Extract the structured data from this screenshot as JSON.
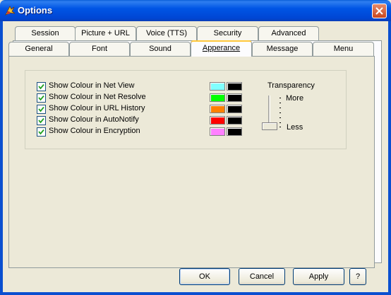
{
  "window": {
    "title": "Options"
  },
  "tabs_back": [
    {
      "label": "Session"
    },
    {
      "label": "Picture + URL"
    },
    {
      "label": "Voice (TTS)"
    },
    {
      "label": "Security"
    },
    {
      "label": "Advanced"
    }
  ],
  "tabs_front": [
    {
      "label": "General"
    },
    {
      "label": "Font"
    },
    {
      "label": "Sound"
    },
    {
      "label": "Apperance",
      "active": true
    },
    {
      "label": "Message"
    },
    {
      "label": "Menu"
    }
  ],
  "appearance": {
    "options": [
      {
        "label": "Show Colour in Net View",
        "checked": true,
        "color": "#80ffff",
        "bg_color": "#000000"
      },
      {
        "label": "Show Colour in Net Resolve",
        "checked": true,
        "color": "#00ff00",
        "bg_color": "#000000"
      },
      {
        "label": "Show Colour in URL History",
        "checked": true,
        "color": "#ff8000",
        "bg_color": "#000000"
      },
      {
        "label": "Show Colour in AutoNotify",
        "checked": true,
        "color": "#ff0000",
        "bg_color": "#000000"
      },
      {
        "label": "Show Colour in Encryption",
        "checked": true,
        "color": "#ff80ff",
        "bg_color": "#000000"
      }
    ],
    "transparency": {
      "label": "Transparency",
      "max_label": "More",
      "min_label": "Less",
      "level": 0
    }
  },
  "buttons": {
    "ok": "OK",
    "cancel": "Cancel",
    "apply": "Apply",
    "help": "?"
  }
}
